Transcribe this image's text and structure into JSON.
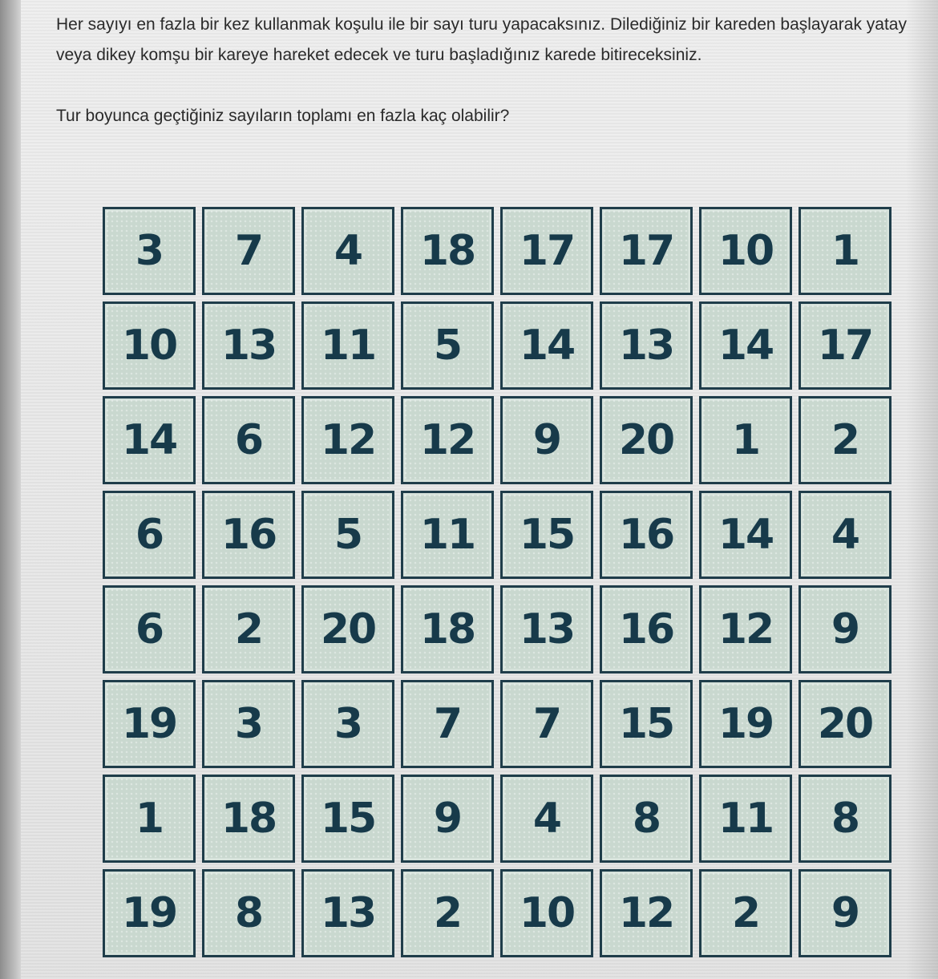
{
  "question": {
    "line1": "Her sayıyı en fazla bir kez kullanmak koşulu ile bir sayı turu yapacaksınız. Dilediğiniz bir kareden başlayarak yatay veya dikey komşu bir kareye hareket edecek ve turu başladığınız karede bitireceksiniz.",
    "line2": "Tur boyunca geçtiğiniz sayıların toplamı en fazla kaç olabilir?"
  },
  "grid": {
    "rows": [
      [
        "3",
        "7",
        "4",
        "18",
        "17",
        "17",
        "10",
        "1"
      ],
      [
        "10",
        "13",
        "11",
        "5",
        "14",
        "13",
        "14",
        "17"
      ],
      [
        "14",
        "6",
        "12",
        "12",
        "9",
        "20",
        "1",
        "2"
      ],
      [
        "6",
        "16",
        "5",
        "11",
        "15",
        "16",
        "14",
        "4"
      ],
      [
        "6",
        "2",
        "20",
        "18",
        "13",
        "16",
        "12",
        "9"
      ],
      [
        "19",
        "3",
        "3",
        "7",
        "7",
        "15",
        "19",
        "20"
      ],
      [
        "1",
        "18",
        "15",
        "9",
        "4",
        "8",
        "11",
        "8"
      ],
      [
        "19",
        "8",
        "13",
        "2",
        "10",
        "12",
        "2",
        "9"
      ]
    ]
  },
  "colors": {
    "cell_border": "#1f3d4a",
    "cell_text": "#173a4a",
    "cell_fill": "#c9d8cf"
  }
}
